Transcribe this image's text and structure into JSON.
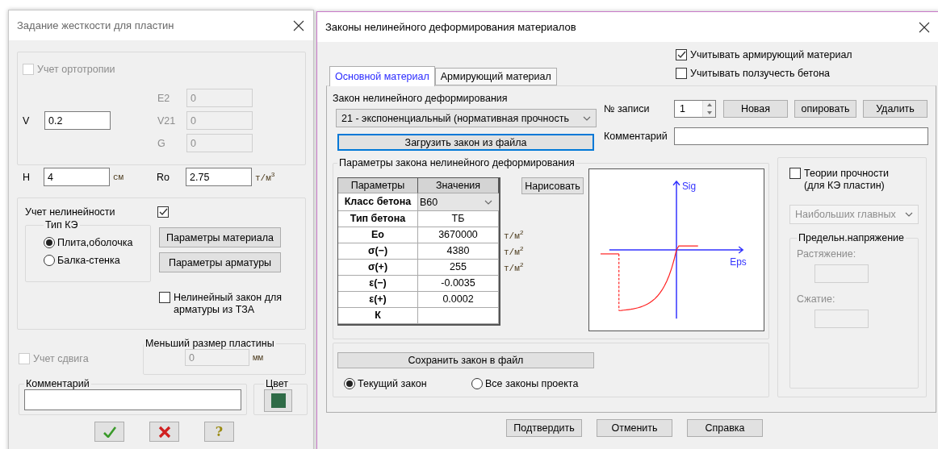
{
  "plate_dialog": {
    "title": "Задание жесткости для пластин",
    "orthotropy": {
      "label": "Учет ортотропии",
      "checked": false,
      "disabled": true
    },
    "v": {
      "label": "V",
      "value": "0.2"
    },
    "orthotropy_fields": [
      {
        "label": "E2",
        "value": "0"
      },
      {
        "label": "V21",
        "value": "0"
      },
      {
        "label": "G",
        "value": "0"
      }
    ],
    "h": {
      "label": "H",
      "value": "4",
      "unit": "см"
    },
    "ro": {
      "label": "Ro",
      "value": "2.75",
      "unit": "т/м$^{3}$"
    },
    "nonlinearity": {
      "label": "Учет нелинейности",
      "checked": true
    },
    "fe_type": {
      "title": "Тип КЭ",
      "options": [
        {
          "label": "Плита,оболочка",
          "selected": true
        },
        {
          "label": "Балка-стенка",
          "selected": false
        }
      ]
    },
    "material_buttons": [
      "Параметры материала",
      "Параметры арматуры"
    ],
    "rebar_law": {
      "label": "Нелинейный закон для арматуры из ТЗА",
      "checked": false
    },
    "shear": {
      "label": "Учет сдвига",
      "checked": false,
      "disabled": true
    },
    "min_size": {
      "title": "Меньший размер пластины",
      "value": "0",
      "unit": "мм",
      "disabled": true
    },
    "comment": {
      "title": "Комментарий"
    },
    "color": {
      "title": "Цвет",
      "color": "#2f6b47"
    },
    "actions": [
      {
        "kind": "ok"
      },
      {
        "kind": "cancel"
      },
      {
        "kind": "help",
        "label": "?"
      }
    ]
  },
  "law_dialog": {
    "title": "Законы нелинейного деформирования материалов",
    "options": [
      {
        "label": "Учитывать армирующий материал",
        "checked": true
      },
      {
        "label": "Учитывать ползучесть бетона",
        "checked": false
      }
    ],
    "tabs": [
      {
        "label": "Основной материал",
        "selected": true
      },
      {
        "label": "Армирующий материал",
        "selected": false
      }
    ],
    "law": {
      "label": "Закон нелинейного деформирования",
      "value": "21 - экспоненциальный (нормативная прочность"
    },
    "load_button": "Загрузить закон из файла",
    "record": {
      "label": "№ записи",
      "value": "1"
    },
    "record_buttons": [
      "Новая",
      "опировать",
      "Удалить"
    ],
    "comment": {
      "label": "Комментарий"
    },
    "params": {
      "title": "Параметры закона нелинейного деформирования",
      "columns": [
        "Параметры",
        "Значения"
      ],
      "rows": [
        {
          "param": "Класс бетона",
          "value": "B60",
          "kind": "select"
        },
        {
          "param": "Тип бетона",
          "value": "ТБ",
          "kind": "text"
        },
        {
          "param": "Eo",
          "value": "3670000",
          "unit": "т/м$^{2}$",
          "kind": "text"
        },
        {
          "param": "σ(−)",
          "value": "4380",
          "unit": "т/м$^{2}$",
          "kind": "text"
        },
        {
          "param": "σ(+)",
          "value": "255",
          "unit": "т/м$^{2}$",
          "kind": "text"
        },
        {
          "param": "ε(−)",
          "value": "-0.0035",
          "kind": "text"
        },
        {
          "param": "ε(+)",
          "value": "0.0002",
          "kind": "text"
        },
        {
          "param": "К",
          "kind": "text"
        }
      ]
    },
    "draw_button": "Нарисовать",
    "plot": {
      "y_label": "Sig",
      "x_label": "Eps"
    },
    "save": {
      "button": "Сохранить закон в файл",
      "scope": [
        {
          "label": "Текущий закон",
          "selected": true
        },
        {
          "label": "Все законы проекта",
          "selected": false
        }
      ]
    },
    "strength": {
      "label": "Теории прочности (для КЭ пластин)",
      "checked": false,
      "theory": "Наибольших главных",
      "limit_title": "Предельн.напряжение",
      "limit_fields": [
        {
          "label": "Растяжение:"
        },
        {
          "label": "Сжатие:"
        }
      ]
    },
    "footer_buttons": [
      "Подтвердить",
      "Отменить",
      "Справка"
    ]
  }
}
